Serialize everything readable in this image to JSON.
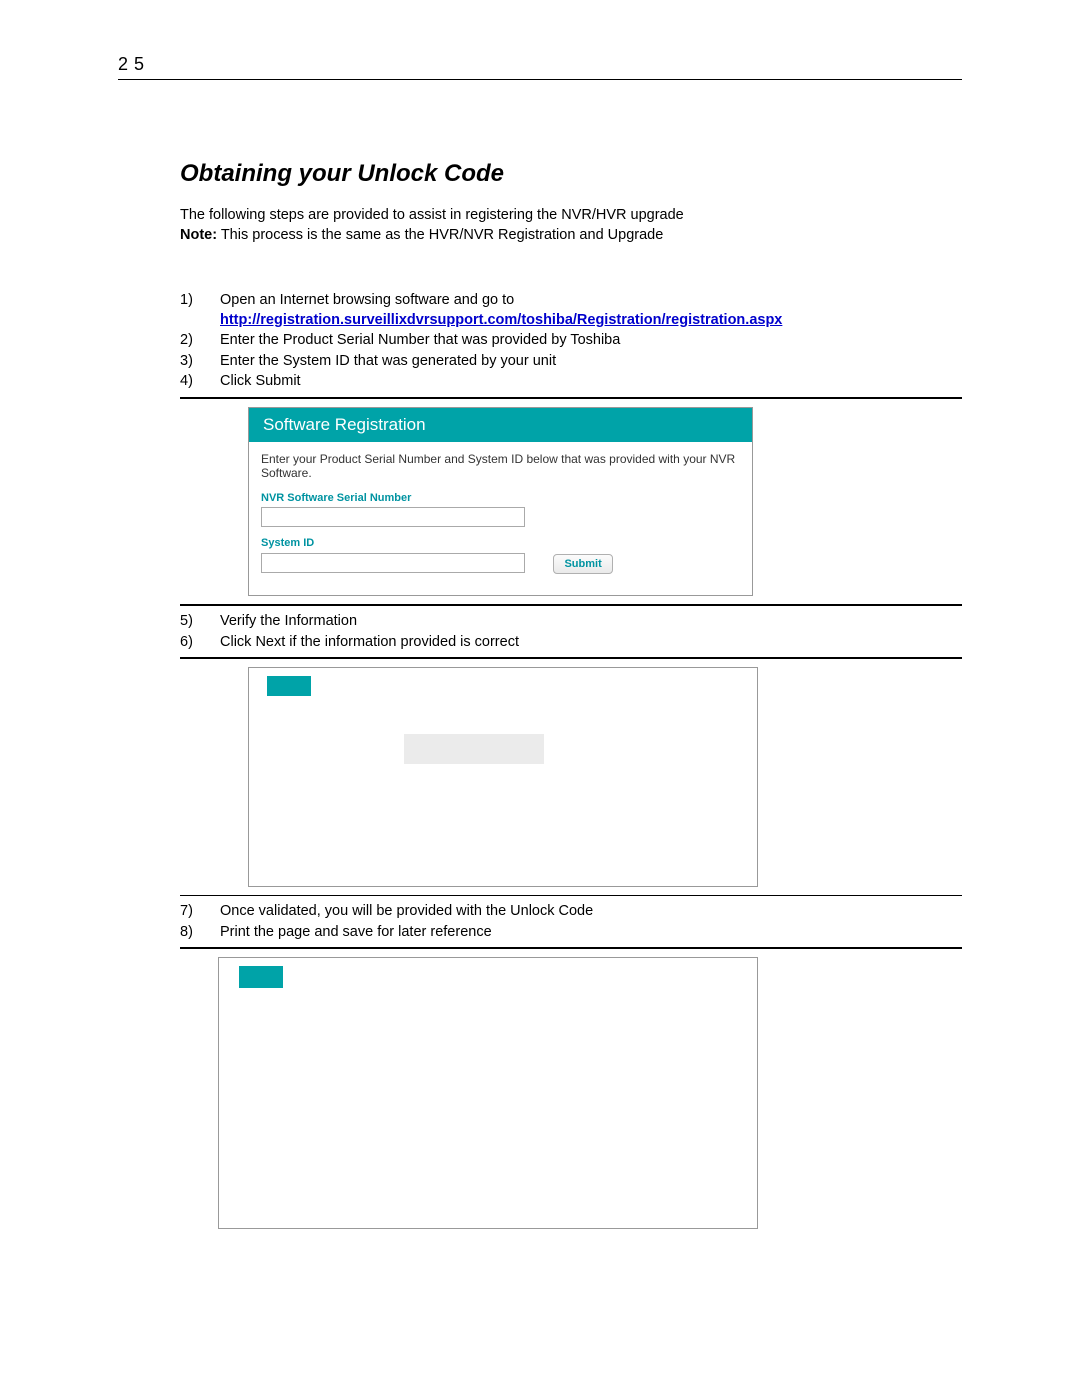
{
  "page_number": "25",
  "section_title": "Obtaining your Unlock Code",
  "intro_line1": "The following steps are provided to assist in registering the NVR/HVR upgrade",
  "note_label": "Note:",
  "intro_line2": " This process is the same as the HVR/NVR Registration and Upgrade",
  "steps_a": [
    {
      "num": "1)",
      "text": "Open an Internet browsing software and go to",
      "link": "http://registration.surveillixdvrsupport.com/toshiba/Registration/registration.aspx"
    },
    {
      "num": "2)",
      "text": "Enter the Product Serial Number that was provided by Toshiba"
    },
    {
      "num": "3)",
      "text": "Enter the System ID that was generated by your unit"
    },
    {
      "num": "4)",
      "text": "Click Submit"
    }
  ],
  "registration_panel": {
    "header": "Software Registration",
    "desc": "Enter your Product Serial Number and System ID below that was provided with your NVR Software.",
    "label_serial": "NVR Software Serial Number",
    "label_system_id": "System ID",
    "submit": "Submit"
  },
  "steps_b": [
    {
      "num": "5)",
      "text": "Verify the Information"
    },
    {
      "num": "6)",
      "text": "Click Next if the information provided is correct"
    }
  ],
  "steps_c": [
    {
      "num": "7)",
      "text": "Once validated, you will be provided with the Unlock Code"
    },
    {
      "num": "8)",
      "text": "Print the page and save for later reference"
    }
  ]
}
